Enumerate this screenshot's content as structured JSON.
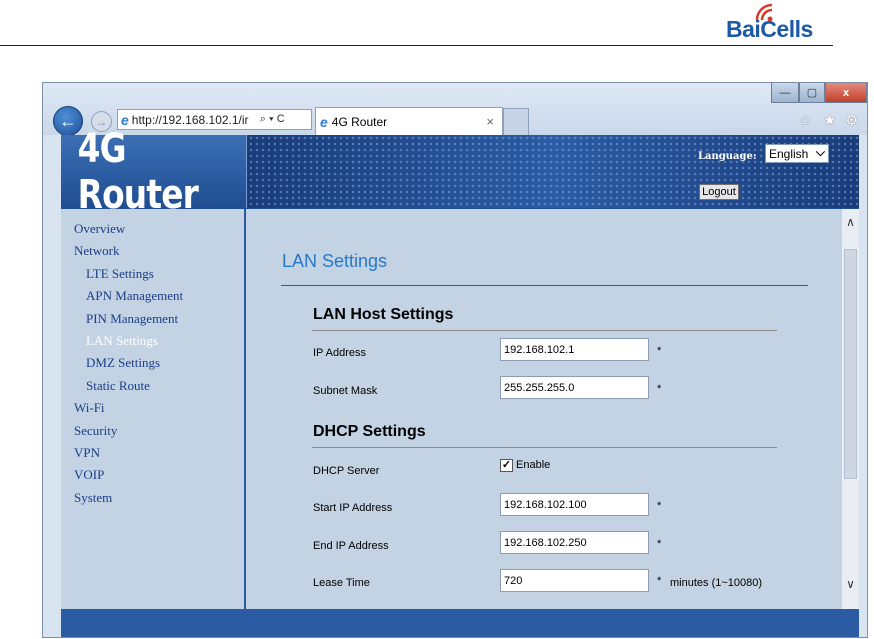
{
  "document": {
    "logo_text": "BaiCells"
  },
  "browser": {
    "address_url": "http://192.168.102.1/ir",
    "tab_title": "4G Router",
    "tab_close": "×",
    "window_buttons": {
      "minimize": "—",
      "maximize": "▢",
      "close": "x"
    },
    "back_glyph": "←",
    "forward_glyph": "→",
    "address_controls": "⌕ ▾ C",
    "toolbar_icons": [
      "home-icon",
      "star-icon",
      "gear-icon"
    ]
  },
  "header": {
    "title": "4G Router",
    "language_label": "Language:",
    "language_value": "English",
    "logout_label": "Logout"
  },
  "sidebar": {
    "items": [
      {
        "label": "Overview",
        "level": "top",
        "active": false
      },
      {
        "label": "Network",
        "level": "top",
        "active": false
      },
      {
        "label": "LTE Settings",
        "level": "sub",
        "active": false
      },
      {
        "label": "APN Management",
        "level": "sub",
        "active": false
      },
      {
        "label": "PIN Management",
        "level": "sub",
        "active": false
      },
      {
        "label": "LAN Settings",
        "level": "sub",
        "active": true
      },
      {
        "label": "DMZ Settings",
        "level": "sub",
        "active": false
      },
      {
        "label": "Static Route",
        "level": "sub",
        "active": false
      },
      {
        "label": "Wi-Fi",
        "level": "top",
        "active": false
      },
      {
        "label": "Security",
        "level": "top",
        "active": false
      },
      {
        "label": "VPN",
        "level": "top",
        "active": false
      },
      {
        "label": "VOIP",
        "level": "top",
        "active": false
      },
      {
        "label": "System",
        "level": "top",
        "active": false
      }
    ]
  },
  "main": {
    "page_title": "LAN Settings",
    "lan_host": {
      "title": "LAN Host Settings",
      "ip_label": "IP Address",
      "ip_value": "192.168.102.1",
      "subnet_label": "Subnet Mask",
      "subnet_value": "255.255.255.0"
    },
    "dhcp": {
      "title": "DHCP Settings",
      "server_label": "DHCP Server",
      "enable_label": "Enable",
      "enabled": true,
      "start_label": "Start IP Address",
      "start_value": "192.168.102.100",
      "end_label": "End IP Address",
      "end_value": "192.168.102.250",
      "lease_label": "Lease Time",
      "lease_value": "720",
      "lease_hint": "minutes (1~10080)"
    },
    "required_mark": "*"
  },
  "colors": {
    "brand_blue": "#1d3f7d",
    "page_title": "#2678c8",
    "content_bg": "#c3d3e4",
    "nav_link": "#1c3e88",
    "nav_active": "#ffffff"
  }
}
